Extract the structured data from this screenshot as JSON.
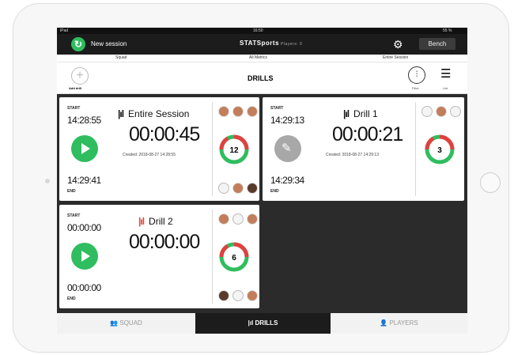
{
  "status": {
    "carrier": "iPad",
    "time": "16:50",
    "battery": "55 %"
  },
  "header": {
    "new_session": "New session",
    "logo": "STATSports",
    "logo_sub": "Players: 0",
    "bench": "Bench"
  },
  "subtabs": [
    "Squad",
    "All Metrics",
    "Entire Session"
  ],
  "toolbar": {
    "add_drill": "Add drill",
    "title": "DRILLS",
    "filter": "Filter",
    "list": "List"
  },
  "cards": [
    {
      "start_label": "START",
      "start_time": "14:28:55",
      "end_time": "14:29:41",
      "end_label": "END",
      "title": "Entire Session",
      "duration": "00:00:45",
      "created": "Created: 2018-08-27 14:28:55",
      "count": "12",
      "avatars_top": [
        "player",
        "player",
        "player"
      ],
      "avatars_bottom": [
        "blank",
        "player",
        "player"
      ]
    },
    {
      "start_label": "START",
      "start_time": "14:29:13",
      "end_time": "14:29:34",
      "end_label": "END",
      "title": "Drill 1",
      "duration": "00:00:21",
      "created": "Created: 2018-08-27 14:29:13",
      "count": "3",
      "avatars_top": [
        "blank",
        "player",
        "blank"
      ]
    },
    {
      "start_label": "START",
      "start_time": "00:00:00",
      "end_time": "00:00:00",
      "end_label": "END",
      "title": "Drill 2",
      "duration": "00:00:00",
      "count": "6",
      "avatars_top": [
        "player",
        "blank",
        "player"
      ],
      "avatars_bottom": [
        "player",
        "blank",
        "player"
      ]
    }
  ],
  "bottomnav": {
    "squad": "SQUAD",
    "drills": "DRILLS",
    "players": "PLAYERS"
  },
  "colors": {
    "accent_green": "#2fbd5f",
    "accent_red": "#e0413f"
  }
}
